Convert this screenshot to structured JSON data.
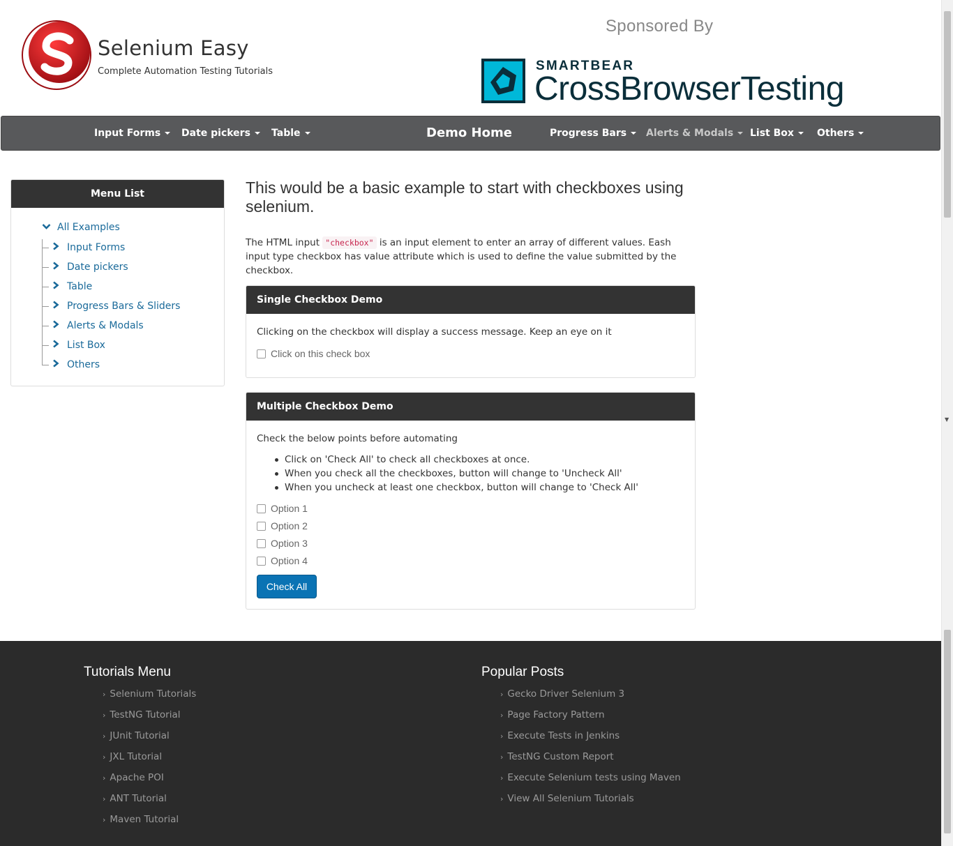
{
  "header": {
    "brand_name": "Selenium Easy",
    "brand_tagline": "Complete Automation Testing Tutorials",
    "sponsor_label": "Sponsored By",
    "sponsor_small": "SMARTBEAR",
    "sponsor_big": "CrossBrowserTesting"
  },
  "navbar": {
    "items": [
      {
        "label": "Input Forms"
      },
      {
        "label": "Date pickers"
      },
      {
        "label": "Table"
      },
      {
        "label": "Demo Home"
      },
      {
        "label": "Progress Bars"
      },
      {
        "label": "Alerts & Modals"
      },
      {
        "label": "List Box"
      },
      {
        "label": "Others"
      }
    ]
  },
  "sidebar": {
    "title": "Menu List",
    "root": "All Examples",
    "items": [
      {
        "label": "Input Forms"
      },
      {
        "label": "Date pickers"
      },
      {
        "label": "Table"
      },
      {
        "label": "Progress Bars & Sliders"
      },
      {
        "label": "Alerts & Modals"
      },
      {
        "label": "List Box"
      },
      {
        "label": "Others"
      }
    ]
  },
  "main": {
    "title": "This would be a basic example to start with checkboxes using selenium.",
    "desc_before": "The HTML input ",
    "desc_code": "\"checkbox\"",
    "desc_after": " is an input element to enter an array of different values. Eash input type checkbox has value attribute which is used to define the value submitted by the checkbox."
  },
  "single_demo": {
    "title": "Single Checkbox Demo",
    "text": "Clicking on the checkbox will display a success message. Keep an eye on it",
    "checkbox_label": "Click on this check box",
    "checked": false
  },
  "multi_demo": {
    "title": "Multiple Checkbox Demo",
    "intro": "Check the below points before automating",
    "bullets": [
      "Click on 'Check All' to check all checkboxes at once.",
      "When you check all the checkboxes, button will change to 'Uncheck All'",
      "When you uncheck at least one checkbox, button will change to 'Check All'"
    ],
    "options": [
      {
        "label": "Option 1",
        "checked": false
      },
      {
        "label": "Option 2",
        "checked": false
      },
      {
        "label": "Option 3",
        "checked": false
      },
      {
        "label": "Option 4",
        "checked": false
      }
    ],
    "button_label": "Check All"
  },
  "footer": {
    "tutorials_title": "Tutorials Menu",
    "tutorials": [
      "Selenium Tutorials",
      "TestNG Tutorial",
      "JUnit Tutorial",
      "JXL Tutorial",
      "Apache POI",
      "ANT Tutorial",
      "Maven Tutorial"
    ],
    "posts_title": "Popular Posts",
    "posts": [
      "Gecko Driver Selenium 3",
      "Page Factory Pattern",
      "Execute Tests in Jenkins",
      "TestNG Custom Report",
      "Execute Selenium tests using Maven",
      "View All Selenium Tutorials"
    ]
  },
  "colors": {
    "navbar_bg": "#58595b",
    "panel_head_bg": "#333333",
    "link": "#1a6a9a",
    "primary_button": "#0a73b4",
    "footer_bg": "#2b2b2b",
    "logo_red": "#c8102e",
    "sponsor_teal": "#00b8d9"
  },
  "icons": {
    "tree_expanded": "chevron-down-icon",
    "tree_collapsed": "chevron-right-icon",
    "dropdown": "caret-down-icon",
    "footer_bullet": "angle-right-icon"
  }
}
